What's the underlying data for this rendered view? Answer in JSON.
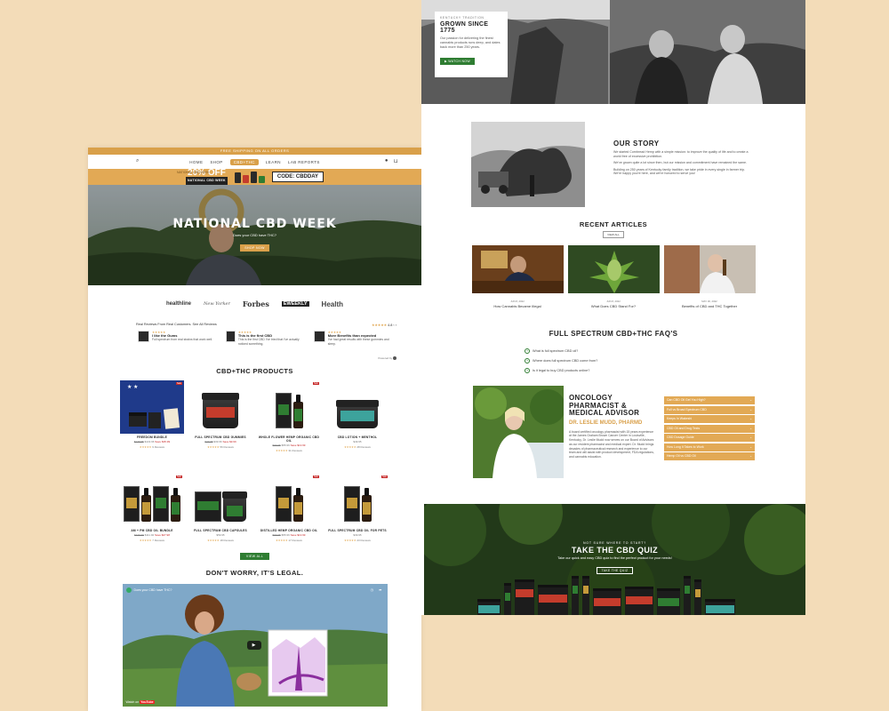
{
  "left": {
    "announcement": "FREE SHIPPING ON ALL ORDERS",
    "nav": {
      "links": [
        "HOME",
        "SHOP",
        "CBD+THC",
        "LEARN",
        "LAB REPORTS"
      ]
    },
    "promo": {
      "small": "NATIONAL CBD WEEK",
      "off": "20% OFF",
      "off_sub": "NATIONAL CBD WEEK",
      "code": "CODE: CBDDAY"
    },
    "hero": {
      "title": "NATIONAL CBD WEEK",
      "subtitle": "Does your CBD have THC?",
      "button": "SHOP NOW"
    },
    "press": [
      "healthline",
      "New Yorker",
      "Forbes",
      "EWEEKLY",
      "Health"
    ],
    "reviews": {
      "header": "Real Reviews From Real Customers. See All Reviews",
      "summary": "4.8",
      "cards": [
        {
          "title": "I like the Gums",
          "text": "Full spectrum from real strains that work well."
        },
        {
          "title": "This is the first CBD",
          "text": "This is the first CBD I've tried that I've actually noticed something."
        },
        {
          "title": "More Benefits than expected",
          "text": "I've had great results with these gummies and sleep."
        }
      ],
      "powered": "Powered by"
    },
    "products": {
      "title": "CBD+THC PRODUCTS",
      "items": [
        {
          "name": "FREEDOM BUNDLE",
          "old": "$179.95",
          "price": "$143.96",
          "save": "Save $35.99",
          "reviews": "9 Reviews",
          "sale": "Sale"
        },
        {
          "name": "FULL SPECTRUM CBD GUMMIES",
          "old": "$49.95",
          "price": "$39.96",
          "save": "Save $9.99",
          "reviews": "56 Reviews",
          "sale": ""
        },
        {
          "name": "WHOLE FLOWER HEMP ORGANIC CBD OIL",
          "old": "$69.95",
          "price": "$55.96",
          "save": "Save $13.99",
          "reviews": "31 Reviews",
          "sale": "Sale"
        },
        {
          "name": "CBD LOTION + MENTHOL",
          "old": "",
          "price": "$49.95",
          "save": "",
          "reviews": "28 Reviews",
          "sale": ""
        },
        {
          "name": "AM + PM CBD OIL BUNDLE",
          "old": "$139.90",
          "price": "$111.92",
          "save": "Save $27.98",
          "reviews": "7 Reviews",
          "sale": "Sale"
        },
        {
          "name": "FULL SPECTRUM CBD CAPSULES",
          "old": "",
          "price": "$59.95",
          "save": "",
          "reviews": "18 Reviews",
          "sale": ""
        },
        {
          "name": "DISTILLED HEMP ORGANIC CBD OIL",
          "old": "$69.95",
          "price": "$55.96",
          "save": "Save $13.99",
          "reviews": "17 Reviews",
          "sale": "Sale"
        },
        {
          "name": "FULL SPECTRUM CBD OIL FOR PETS",
          "old": "",
          "price": "$39.95",
          "save": "",
          "reviews": "23 Reviews",
          "sale": "Sale"
        }
      ],
      "view_all": "VIEW ALL"
    },
    "legal": {
      "title": "DON'T WORRY, IT'S LEGAL.",
      "video_title": "Does your CBD have THC?",
      "watch_on": "Watch on",
      "youtube": "YouTube"
    }
  },
  "right": {
    "tradition": {
      "kicker": "KENTUCKY TRADITION",
      "title": "GROWN SINCE 1775",
      "text": "Our passion for delivering the finest cannabis products runs deep, and dates back more than 250 years.",
      "button": "WATCH NOW"
    },
    "story": {
      "title": "OUR STORY",
      "p1": "We started Cornbread Hemp with a simple mission: to improve the quality of life and to create a world free of excessive prohibition.",
      "p2": "We've grown quite a lot since then, but our mission and commitment have remained the same.",
      "p3": "Building on 250 years of Kentucky family tradition, we take pride in every single in farmer trip. We're happy you're here, and we're honored to serve you!"
    },
    "articles": {
      "title": "RECENT ARTICLES",
      "button": "VIEW ALL",
      "items": [
        {
          "date": "JUN 8, 2022",
          "title": "How Cannabis Became Illegal"
        },
        {
          "date": "JUN 8, 2022",
          "title": "What Does CBD Stand For?"
        },
        {
          "date": "MAY 30, 2022",
          "title": "Benefits of CBD and THC Together"
        }
      ]
    },
    "faq": {
      "title": "FULL SPECTRUM CBD+THC FAQ'S",
      "items": [
        "What is full spectrum CBD oil?",
        "Where does full spectrum CBD come from?",
        "Is it legal to buy CBD products online?"
      ]
    },
    "oncology": {
      "title": "ONCOLOGY PHARMACIST & MEDICAL ADVISOR",
      "name": "DR. LESLIE MUDD, PHARMD",
      "bio": "A board certified oncology pharmacist with 15 years experience at the James Graham Brown Cancer Center in Louisville, Kentucky, Dr. Leslie Mudd now serves on our Board of Advisors as our resident pharmacist and medical expert. Dr. Mudd brings decades of pharmaceutical research and experience to our team and will assist with product development, FDA regulations, and cannabis education.",
      "accordion": [
        "Can CBD Oil Get You High?",
        "Full vs Broad Spectrum CBD",
        "Keeps In Wakeshi",
        "CBD Oil and Drug Tests",
        "CBD Dosage Guide",
        "How Long It Takes to Work",
        "Hemp Oil vs CBD Oil"
      ]
    },
    "quiz": {
      "kicker": "NOT SURE WHERE TO START?",
      "title": "TAKE THE CBD QUIZ",
      "subtitle": "Take our quick and easy CBD quiz to find the perfect product for your needs!",
      "button": "TAKE THE QUIZ",
      "products": [
        "CBD LOTION",
        "CBD BALM",
        "CBD GUMMIES",
        "CBD CAPSULES",
        "CBD LOTION"
      ]
    }
  }
}
